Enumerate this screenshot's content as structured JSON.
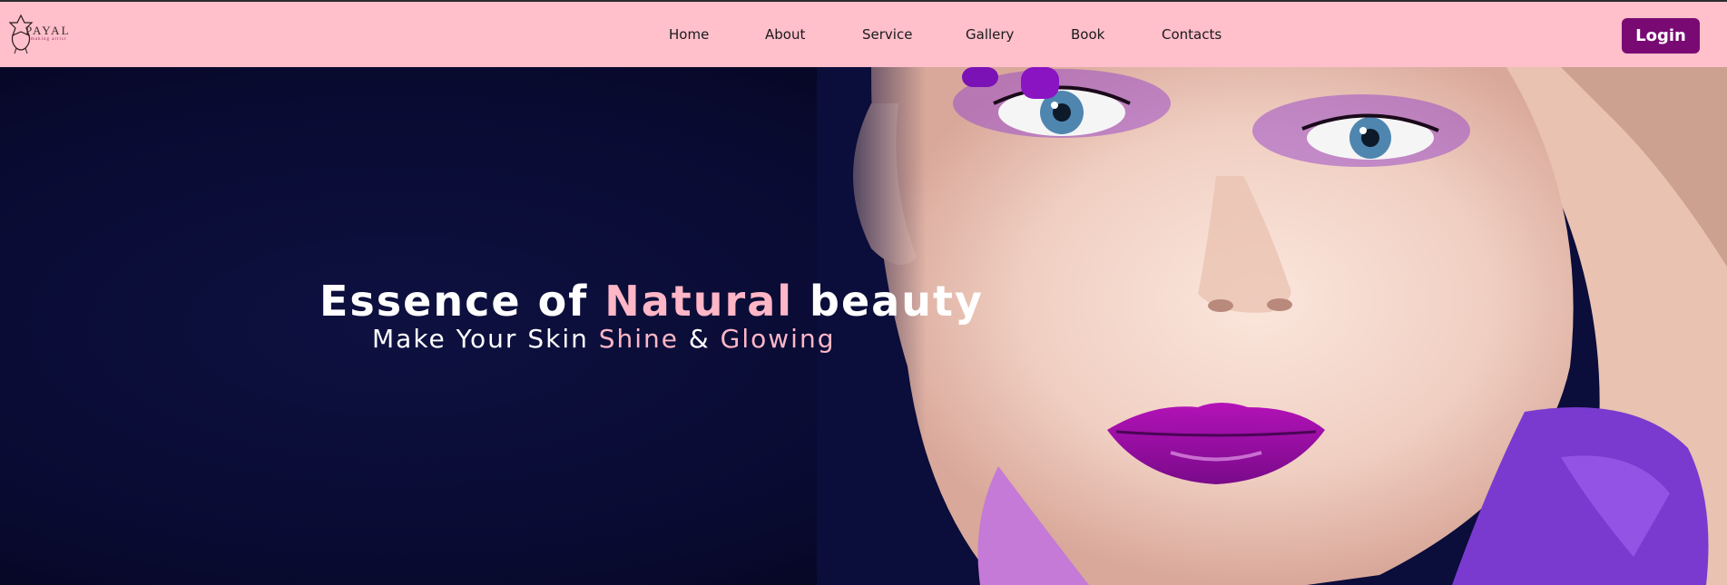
{
  "brand": {
    "name": "PAYAL",
    "tagline": "making artist"
  },
  "nav": {
    "items": [
      {
        "label": "Home"
      },
      {
        "label": "About"
      },
      {
        "label": "Service"
      },
      {
        "label": "Gallery"
      },
      {
        "label": "Book"
      },
      {
        "label": "Contacts"
      }
    ],
    "login_label": "Login"
  },
  "hero": {
    "headline": {
      "part1": "Essence of ",
      "accent": "Natural",
      "part2": " beauty"
    },
    "subline": {
      "part1": "Make Your Skin ",
      "accent1": "Shine",
      "part2": " & ",
      "accent2": "Glowing"
    }
  },
  "colors": {
    "navbar_bg": "#ffbfcb",
    "login_bg": "#7a0a73",
    "hero_bg": "#0b0d3a",
    "accent_pink": "#ffb6c6"
  },
  "icons": {
    "logo": "lotus-logo-icon"
  }
}
